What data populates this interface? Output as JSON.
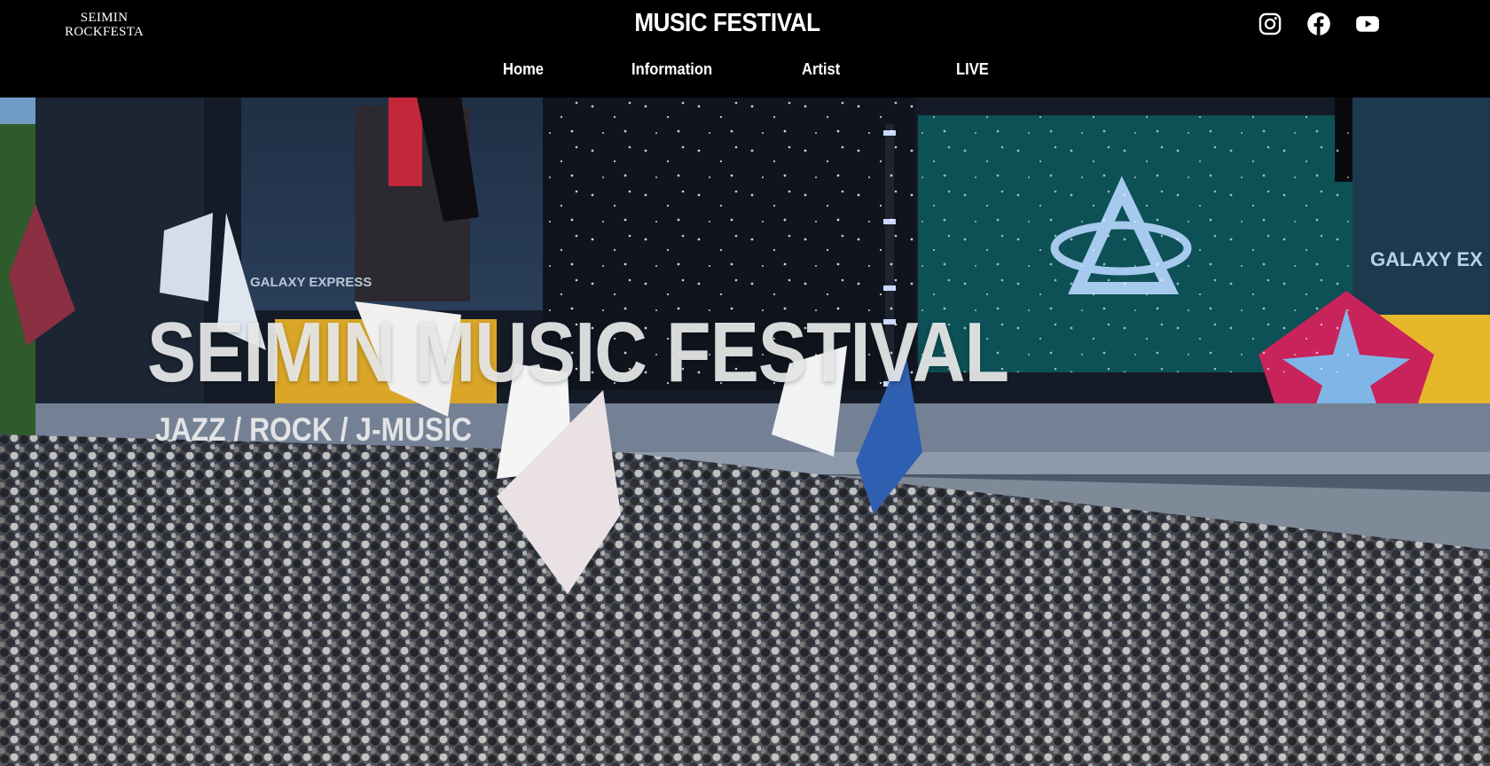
{
  "header": {
    "logo_line1": "SEIMIN",
    "logo_line2": "ROCKFESTA",
    "site_title": "MUSIC FESTIVAL",
    "social_icons": [
      "instagram-icon",
      "facebook-icon",
      "youtube-icon"
    ]
  },
  "nav": {
    "items": [
      {
        "label": "Home"
      },
      {
        "label": "Information"
      },
      {
        "label": "Artist"
      },
      {
        "label": "LIVE"
      }
    ]
  },
  "hero": {
    "title": "SEIMIN MUSIC FESTIVAL",
    "subtitle": "JAZZ / ROCK / J-MUSIC",
    "screen_caption_left": "GALAXY EXPRESS",
    "screen_caption_right": "GALAXY EX"
  },
  "colors": {
    "header_bg": "#000000",
    "text": "#ffffff",
    "star_badge": "#c8235a",
    "star": "#7fb6e8",
    "stage_panel": "#e6b62b",
    "screen_right": "#0d5056"
  }
}
